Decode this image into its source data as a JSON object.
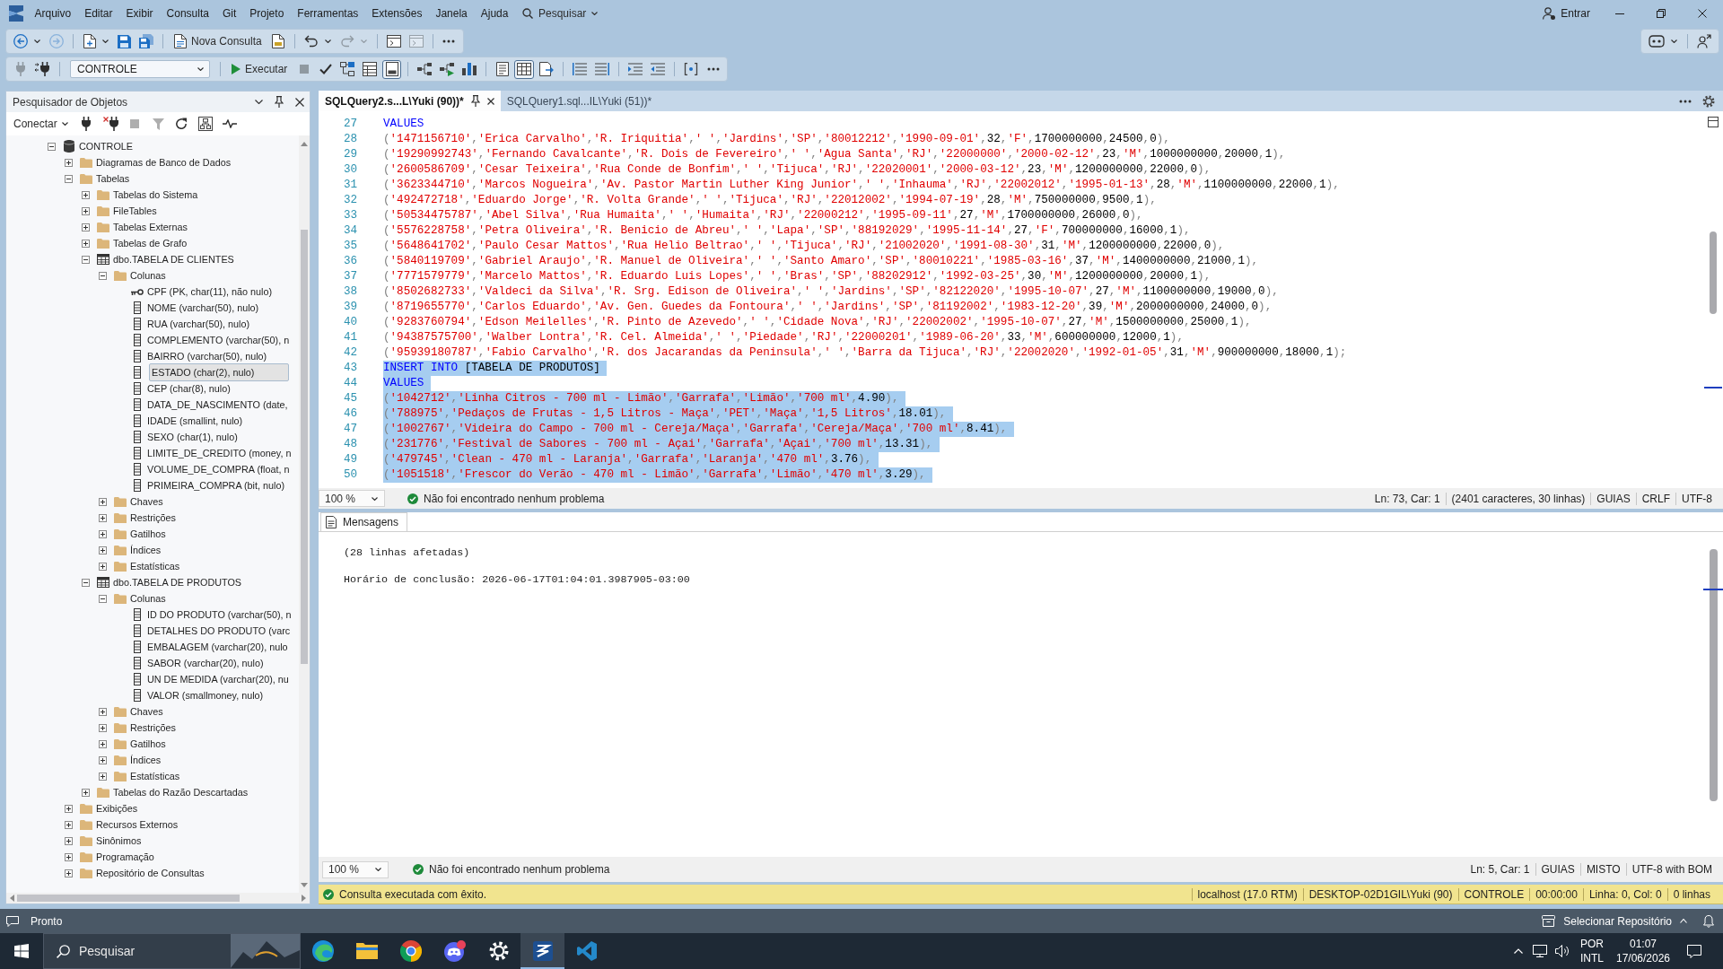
{
  "titlebar": {
    "menus": [
      "Arquivo",
      "Editar",
      "Exibir",
      "Consulta",
      "Git",
      "Projeto",
      "Ferramentas",
      "Extensões",
      "Janela",
      "Ajuda"
    ],
    "search_label": "Pesquisar",
    "account_label": "Entrar"
  },
  "toolbar_standard": {
    "groups": [
      [
        {
          "kind": "back",
          "disabled": false
        },
        {
          "kind": "caret",
          "disabled": false
        },
        {
          "kind": "forward",
          "disabled": true
        }
      ],
      [
        {
          "kind": "new-file",
          "disabled": false
        },
        {
          "kind": "caret",
          "disabled": false
        },
        {
          "kind": "save",
          "disabled": false
        },
        {
          "kind": "save-all",
          "disabled": false
        }
      ],
      [
        {
          "kind": "new-query",
          "label": "Nova Consulta",
          "disabled": false
        },
        {
          "kind": "query-file",
          "disabled": false
        }
      ],
      [
        {
          "kind": "undo",
          "disabled": false
        },
        {
          "kind": "caret",
          "disabled": false
        },
        {
          "kind": "redo",
          "disabled": true
        },
        {
          "kind": "caret",
          "disabled": true
        }
      ],
      [
        {
          "kind": "window",
          "disabled": false
        },
        {
          "kind": "window",
          "disabled": true
        }
      ],
      [
        {
          "kind": "more",
          "disabled": false
        }
      ]
    ],
    "trailing_groups": [
      [
        {
          "kind": "assistant",
          "disabled": false
        },
        {
          "kind": "caret",
          "disabled": false
        }
      ],
      [
        {
          "kind": "feedback",
          "disabled": false
        }
      ]
    ]
  },
  "toolbar_query": {
    "groups": [
      [
        {
          "kind": "connect",
          "disabled": true,
          "on": false
        },
        {
          "kind": "change-connection",
          "disabled": false,
          "on": false
        }
      ],
      [
        {
          "kind": "database-select",
          "value": "CONTROLE",
          "disabled": false
        }
      ],
      [
        {
          "kind": "execute",
          "label": "Executar",
          "disabled": false,
          "on": false
        },
        {
          "kind": "stop",
          "disabled": true,
          "on": false
        },
        {
          "kind": "check",
          "disabled": false,
          "on": false
        },
        {
          "kind": "flowchart",
          "disabled": false,
          "on": false
        },
        {
          "kind": "query-design",
          "disabled": false,
          "on": false
        },
        {
          "kind": "results-pane",
          "disabled": false,
          "on": true
        }
      ],
      [
        {
          "kind": "plan",
          "disabled": false,
          "on": false
        },
        {
          "kind": "live-plan",
          "disabled": false,
          "on": false
        },
        {
          "kind": "client-stats",
          "disabled": false,
          "on": false
        }
      ],
      [
        {
          "kind": "results-text",
          "disabled": false,
          "on": false
        },
        {
          "kind": "results-grid",
          "disabled": false,
          "on": true
        },
        {
          "kind": "results-file",
          "disabled": false,
          "on": false
        }
      ],
      [
        {
          "kind": "comment",
          "disabled": false,
          "on": false
        },
        {
          "kind": "uncomment",
          "disabled": false,
          "on": false
        }
      ],
      [
        {
          "kind": "indent",
          "disabled": false,
          "on": false
        },
        {
          "kind": "outdent",
          "disabled": false,
          "on": false
        }
      ],
      [
        {
          "kind": "template",
          "disabled": false,
          "on": false
        },
        {
          "kind": "more",
          "disabled": false,
          "on": false
        }
      ]
    ]
  },
  "object_explorer": {
    "title": "Pesquisador de Objetos",
    "toolbar": [
      {
        "kind": "connect-menu",
        "label": "Conectar",
        "disabled": false
      },
      {
        "kind": "connect",
        "disabled": false
      },
      {
        "kind": "disconnect",
        "disabled": false
      },
      {
        "kind": "stop",
        "disabled": true
      },
      {
        "kind": "filter",
        "disabled": true
      },
      {
        "kind": "refresh",
        "disabled": false
      },
      {
        "kind": "diagram",
        "disabled": false
      },
      {
        "kind": "activity",
        "disabled": false
      }
    ],
    "tree": [
      {
        "label": "CONTROLE",
        "kind": "database",
        "expanded": true,
        "selected": false,
        "children": [
          {
            "label": "Diagramas de Banco de Dados",
            "kind": "folder",
            "expanded": false,
            "selected": false
          },
          {
            "label": "Tabelas",
            "kind": "folder",
            "expanded": true,
            "selected": false,
            "children": [
              {
                "label": "Tabelas do Sistema",
                "kind": "folder",
                "expanded": false,
                "selected": false
              },
              {
                "label": "FileTables",
                "kind": "folder",
                "expanded": false,
                "selected": false
              },
              {
                "label": "Tabelas Externas",
                "kind": "folder",
                "expanded": false,
                "selected": false
              },
              {
                "label": "Tabelas de Grafo",
                "kind": "folder",
                "expanded": false,
                "selected": false
              },
              {
                "label": "dbo.TABELA DE CLIENTES",
                "kind": "table",
                "expanded": true,
                "selected": false,
                "children": [
                  {
                    "label": "Colunas",
                    "kind": "folder",
                    "expanded": true,
                    "selected": false,
                    "children": [
                      {
                        "label": "CPF (PK, char(11), não nulo)",
                        "kind": "key-column",
                        "selected": false
                      },
                      {
                        "label": "NOME (varchar(50), nulo)",
                        "kind": "column",
                        "selected": false
                      },
                      {
                        "label": "RUA (varchar(50), nulo)",
                        "kind": "column",
                        "selected": false
                      },
                      {
                        "label": "COMPLEMENTO (varchar(50), n",
                        "kind": "column",
                        "selected": false
                      },
                      {
                        "label": "BAIRRO (varchar(50), nulo)",
                        "kind": "column",
                        "selected": false
                      },
                      {
                        "label": "ESTADO (char(2), nulo)",
                        "kind": "column",
                        "selected": true
                      },
                      {
                        "label": "CEP (char(8), nulo)",
                        "kind": "column",
                        "selected": false
                      },
                      {
                        "label": "DATA_DE_NASCIMENTO (date,",
                        "kind": "column",
                        "selected": false
                      },
                      {
                        "label": "IDADE (smallint, nulo)",
                        "kind": "column",
                        "selected": false
                      },
                      {
                        "label": "SEXO (char(1), nulo)",
                        "kind": "column",
                        "selected": false
                      },
                      {
                        "label": "LIMITE_DE_CREDITO (money, n",
                        "kind": "column",
                        "selected": false
                      },
                      {
                        "label": "VOLUME_DE_COMPRA (float, n",
                        "kind": "column",
                        "selected": false
                      },
                      {
                        "label": "PRIMEIRA_COMPRA (bit, nulo)",
                        "kind": "column",
                        "selected": false
                      }
                    ]
                  },
                  {
                    "label": "Chaves",
                    "kind": "folder",
                    "expanded": false,
                    "selected": false
                  },
                  {
                    "label": "Restrições",
                    "kind": "folder",
                    "expanded": false,
                    "selected": false
                  },
                  {
                    "label": "Gatilhos",
                    "kind": "folder",
                    "expanded": false,
                    "selected": false
                  },
                  {
                    "label": "Índices",
                    "kind": "folder",
                    "expanded": false,
                    "selected": false
                  },
                  {
                    "label": "Estatísticas",
                    "kind": "folder",
                    "expanded": false,
                    "selected": false
                  }
                ]
              },
              {
                "label": "dbo.TABELA DE PRODUTOS",
                "kind": "table",
                "expanded": true,
                "selected": false,
                "children": [
                  {
                    "label": "Colunas",
                    "kind": "folder",
                    "expanded": true,
                    "selected": false,
                    "children": [
                      {
                        "label": "ID DO PRODUTO (varchar(50), n",
                        "kind": "column",
                        "selected": false
                      },
                      {
                        "label": "DETALHES DO PRODUTO (varc",
                        "kind": "column",
                        "selected": false
                      },
                      {
                        "label": "EMBALAGEM (varchar(20), nulo",
                        "kind": "column",
                        "selected": false
                      },
                      {
                        "label": "SABOR (varchar(20), nulo)",
                        "kind": "column",
                        "selected": false
                      },
                      {
                        "label": "UN DE MEDIDA (varchar(20), nu",
                        "kind": "column",
                        "selected": false
                      },
                      {
                        "label": "VALOR (smallmoney, nulo)",
                        "kind": "column",
                        "selected": false
                      }
                    ]
                  },
                  {
                    "label": "Chaves",
                    "kind": "folder",
                    "expanded": false,
                    "selected": false
                  },
                  {
                    "label": "Restrições",
                    "kind": "folder",
                    "expanded": false,
                    "selected": false
                  },
                  {
                    "label": "Gatilhos",
                    "kind": "folder",
                    "expanded": false,
                    "selected": false
                  },
                  {
                    "label": "Índices",
                    "kind": "folder",
                    "expanded": false,
                    "selected": false
                  },
                  {
                    "label": "Estatísticas",
                    "kind": "folder",
                    "expanded": false,
                    "selected": false
                  }
                ]
              },
              {
                "label": "Tabelas do Razão Descartadas",
                "kind": "folder",
                "expanded": false,
                "selected": false
              }
            ]
          },
          {
            "label": "Exibições",
            "kind": "folder",
            "expanded": false,
            "selected": false
          },
          {
            "label": "Recursos Externos",
            "kind": "folder",
            "expanded": false,
            "selected": false
          },
          {
            "label": "Sinônimos",
            "kind": "folder",
            "expanded": false,
            "selected": false
          },
          {
            "label": "Programação",
            "kind": "folder",
            "expanded": false,
            "selected": false
          },
          {
            "label": "Repositório de Consultas",
            "kind": "folder",
            "expanded": false,
            "selected": false
          }
        ]
      }
    ]
  },
  "editor": {
    "tabs": [
      {
        "label": "SQLQuery2.s...L\\Yuki (90))*",
        "selected": true
      },
      {
        "label": "SQLQuery1.sql...IL\\Yuki (51))*",
        "selected": false
      }
    ],
    "lines": [
      {
        "number": "27",
        "keyword": "VALUES",
        "selected": false
      },
      {
        "number": "28",
        "text": "('1471156710','Erica Carvalho','R. Iriquitia',' ','Jardins','SP','80012212','1990-09-01',32,'F',1700000000,24500,0),",
        "selected": false
      },
      {
        "number": "29",
        "text": "('19290992743','Fernando Cavalcante','R. Dois de Fevereiro',' ','Agua Santa','RJ','22000000','2000-02-12',23,'M',1000000000,20000,1),",
        "selected": false
      },
      {
        "number": "30",
        "text": "('2600586709','Cesar Teixeira','Rua Conde de Bonfim',' ','Tijuca','RJ','22020001','2000-03-12',23,'M',1200000000,22000,0),",
        "selected": false
      },
      {
        "number": "31",
        "text": "('3623344710','Marcos Nogueira','Av. Pastor Martin Luther King Junior',' ','Inhauma','RJ','22002012','1995-01-13',28,'M',1100000000,22000,1),",
        "selected": false
      },
      {
        "number": "32",
        "text": "('492472718','Eduardo Jorge','R. Volta Grande',' ','Tijuca','RJ','22012002','1994-07-19',28,'M',750000000,9500,1),",
        "selected": false
      },
      {
        "number": "33",
        "text": "('50534475787','Abel Silva','Rua Humaita',' ','Humaita','RJ','22000212','1995-09-11',27,'M',1700000000,26000,0),",
        "selected": false
      },
      {
        "number": "34",
        "text": "('5576228758','Petra Oliveira','R. Benicio de Abreu',' ','Lapa','SP','88192029','1995-11-14',27,'F',700000000,16000,1),",
        "selected": false
      },
      {
        "number": "35",
        "text": "('5648641702','Paulo Cesar Mattos','Rua Helio Beltrao',' ','Tijuca','RJ','21002020','1991-08-30',31,'M',1200000000,22000,0),",
        "selected": false
      },
      {
        "number": "36",
        "text": "('5840119709','Gabriel Araujo','R. Manuel de Oliveira',' ','Santo Amaro','SP','80010221','1985-03-16',37,'M',1400000000,21000,1),",
        "selected": false
      },
      {
        "number": "37",
        "text": "('7771579779','Marcelo Mattos','R. Eduardo Luis Lopes',' ','Bras','SP','88202912','1992-03-25',30,'M',1200000000,20000,1),",
        "selected": false
      },
      {
        "number": "38",
        "text": "('8502682733','Valdeci da Silva','R. Srg. Edison de Oliveira',' ','Jardins','SP','82122020','1995-10-07',27,'M',1100000000,19000,0),",
        "selected": false
      },
      {
        "number": "39",
        "text": "('8719655770','Carlos Eduardo','Av. Gen. Guedes da Fontoura',' ','Jardins','SP','81192002','1983-12-20',39,'M',2000000000,24000,0),",
        "selected": false
      },
      {
        "number": "40",
        "text": "('9283760794','Edson Meilelles','R. Pinto de Azevedo',' ','Cidade Nova','RJ','22002002','1995-10-07',27,'M',1500000000,25000,1),",
        "selected": false
      },
      {
        "number": "41",
        "text": "('94387575700','Walber Lontra','R. Cel. Almeida',' ','Piedade','RJ','22000201','1989-06-20',33,'M',600000000,12000,1),",
        "selected": false
      },
      {
        "number": "42",
        "text": "('95939180787','Fabio Carvalho','R. dos Jacarandas da Peninsula',' ','Barra da Tijuca','RJ','22002020','1992-01-05',31,'M',900000000,18000,1);",
        "selected": false
      },
      {
        "number": "43",
        "keyword": "INSERT INTO",
        "text": " [TABELA DE PRODUTOS]",
        "selected": true
      },
      {
        "number": "44",
        "keyword": "VALUES",
        "selected": true
      },
      {
        "number": "45",
        "text": "('1042712','Linha Citros - 700 ml - Limão','Garrafa','Limão','700 ml',4.90),",
        "selected": true
      },
      {
        "number": "46",
        "text": "('788975','Pedaços de Frutas - 1,5 Litros - Maça','PET','Maça','1,5 Litros',18.01),",
        "selected": true
      },
      {
        "number": "47",
        "text": "('1002767','Videira do Campo - 700 ml - Cereja/Maça','Garrafa','Cereja/Maça','700 ml',8.41),",
        "selected": true
      },
      {
        "number": "48",
        "text": "('231776','Festival de Sabores - 700 ml - Açai','Garrafa','Açai','700 ml',13.31),",
        "selected": true
      },
      {
        "number": "49",
        "text": "('479745','Clean - 470 ml - Laranja','Garrafa','Laranja','470 ml',3.76),",
        "selected": true
      },
      {
        "number": "50",
        "text": "('1051518','Frescor do Verão - 470 ml - Limão','Garrafa','Limão','470 ml',3.29),",
        "selected": true
      }
    ],
    "status": {
      "zoom": "100 %",
      "issues": "Não foi encontrado nenhum problema",
      "fields": [
        "Ln: 73, Car: 1",
        "(2401 caracteres, 30 linhas)",
        "GUIAS",
        "CRLF",
        "UTF-8"
      ]
    }
  },
  "results": {
    "tabs": [
      {
        "label": "Mensagens",
        "selected": true
      }
    ],
    "messages": [
      "(28 linhas afetadas)",
      "Horário de conclusão: 2026-06-17T01:04:01.3987905-03:00"
    ],
    "status": {
      "zoom": "100 %",
      "issues": "Não foi encontrado nenhum problema",
      "fields": [
        "Ln: 5, Car: 1",
        "GUIAS",
        "MISTO",
        "UTF-8 with BOM"
      ]
    },
    "query_status": {
      "message": "Consulta executada com êxito.",
      "fields": [
        "localhost (17.0 RTM)",
        "DESKTOP-02D1GIL\\Yuki (90)",
        "CONTROLE",
        "00:00:00",
        "Linha: 0, Col: 0",
        "0 linhas"
      ]
    }
  },
  "app_status": {
    "text": "Pronto",
    "repository": "Selecionar Repositório"
  },
  "taskbar": {
    "search": {
      "placeholder": "Pesquisar"
    },
    "apps": [
      {
        "kind": "browser",
        "selected": false
      },
      {
        "kind": "file-manager",
        "selected": false
      },
      {
        "kind": "web-browser",
        "selected": false
      },
      {
        "kind": "chat",
        "selected": false
      },
      {
        "kind": "settings",
        "selected": false
      },
      {
        "kind": "database-studio",
        "selected": true
      },
      {
        "kind": "code-editor",
        "selected": false
      }
    ],
    "language": [
      "POR",
      "INTL"
    ],
    "time": "01:07",
    "date": "17/06/2026"
  }
}
